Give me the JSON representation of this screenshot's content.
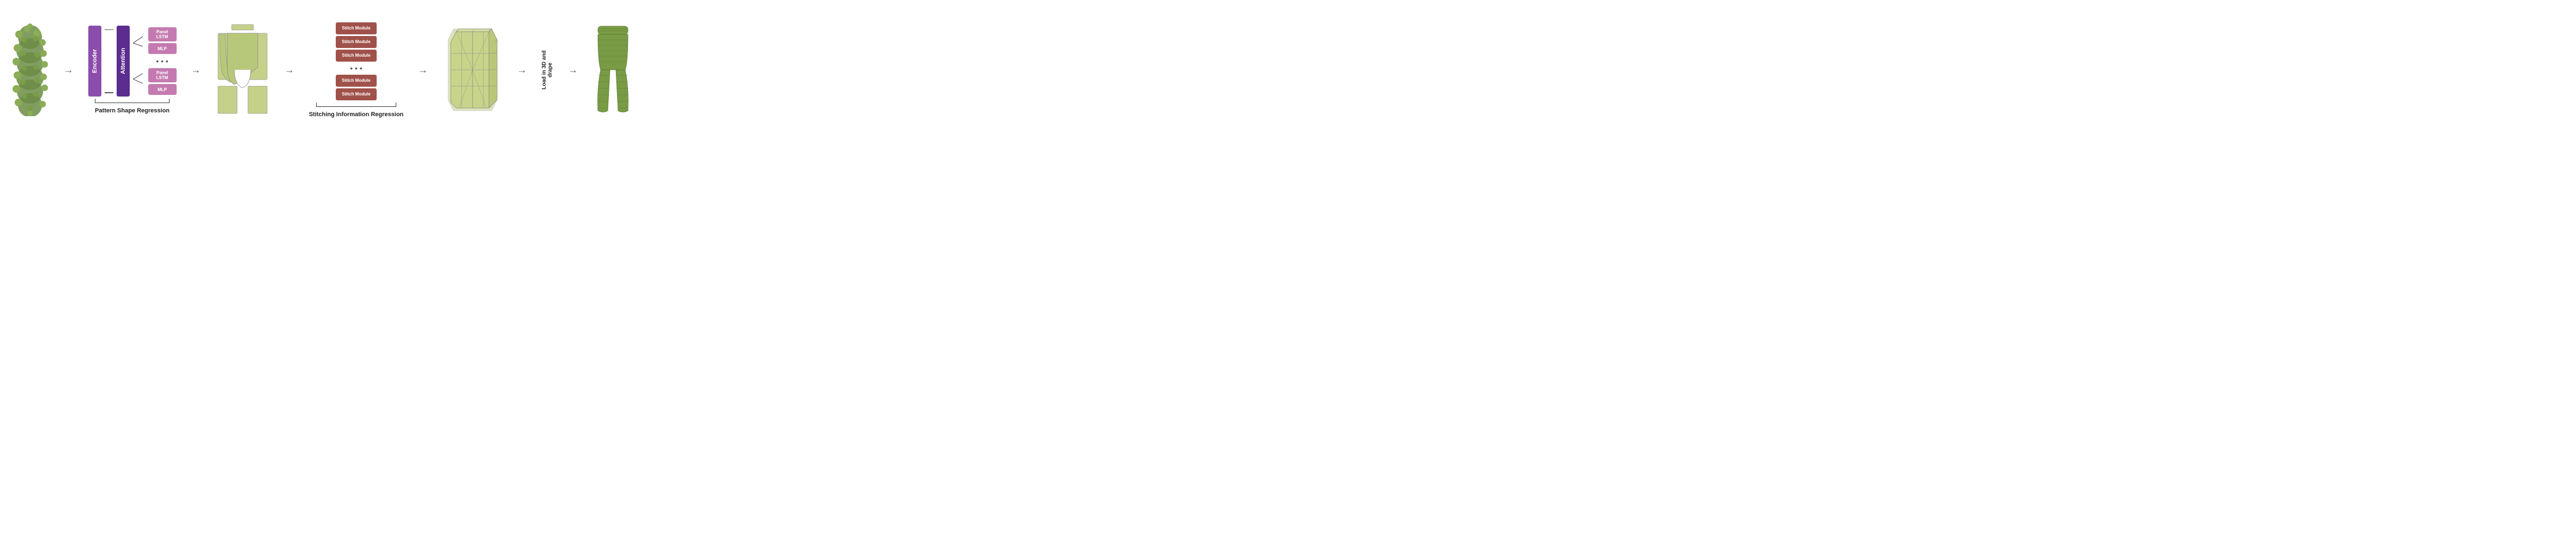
{
  "pipeline": {
    "sections": {
      "psr_label": "Pattern Shape Regression",
      "sir_label": "Stitching Information Regression",
      "load_label": "Load in 3D\nand drape"
    },
    "blocks": {
      "encoder": "Encoder",
      "attention": "Attention",
      "panel_lstm": "Panel\nLSTM",
      "mlp": "MLP",
      "stitch_module": "Stitch Module"
    },
    "stitch_modules": [
      "Stitch Module",
      "Stitch Module",
      "Stitch Module",
      "Stitch Module",
      "Stitch Module"
    ],
    "dots": "• • •"
  }
}
